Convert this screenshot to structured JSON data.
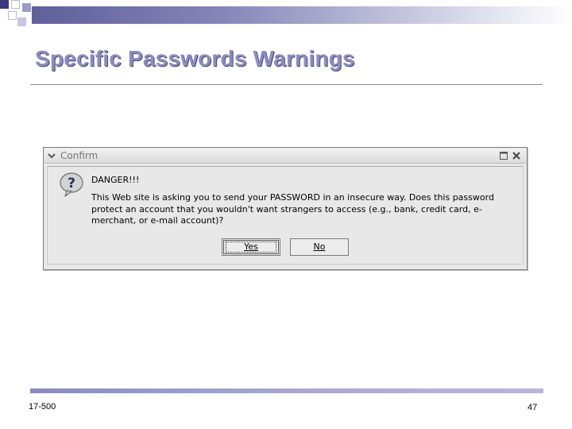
{
  "slide": {
    "title": "Specific Passwords Warnings",
    "footer_left": "17-500",
    "page_number": "47"
  },
  "dialog": {
    "title": "Confirm",
    "heading": "DANGER!!!",
    "message": "This Web site is asking you to send your PASSWORD in an insecure way. Does this password protect an account that you wouldn't want strangers to access (e.g., bank, credit card, e-merchant, or e-mail account)?",
    "icon": "question-icon",
    "buttons": {
      "yes_label": "Yes",
      "no_label": "No"
    },
    "titlebar_icons": [
      "chevron-down-icon",
      "maximize-icon",
      "close-icon"
    ]
  },
  "colors": {
    "title_text": "#8c8cc2",
    "accent_band": "#7070aa",
    "dialog_bg": "#e8e8e8"
  }
}
